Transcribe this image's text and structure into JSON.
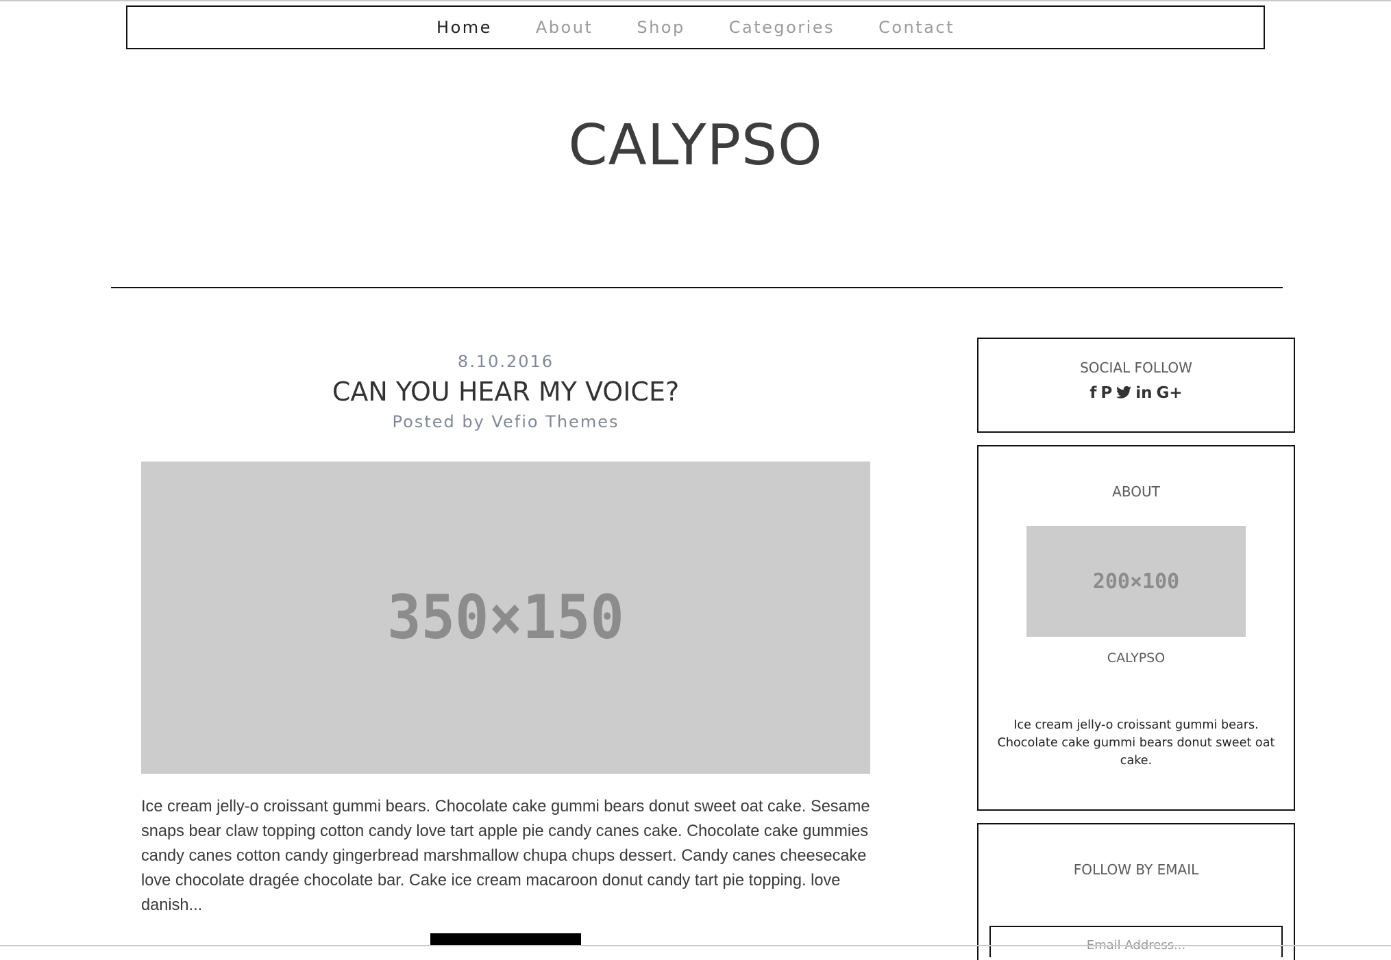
{
  "nav": {
    "items": [
      {
        "label": "Home",
        "active": true
      },
      {
        "label": "About",
        "active": false
      },
      {
        "label": "Shop",
        "active": false
      },
      {
        "label": "Categories",
        "active": false
      },
      {
        "label": "Contact",
        "active": false
      }
    ]
  },
  "site": {
    "title": "CALYPSO"
  },
  "post": {
    "date": "8.10.2016",
    "title": "CAN YOU HEAR MY VOICE?",
    "author": "Posted by Vefio Themes",
    "image_label": "350×150",
    "excerpt": "Ice cream jelly-o croissant gummi bears. Chocolate cake gummi bears donut sweet oat cake. Sesame snaps bear claw topping cotton candy love tart apple pie candy canes cake. Chocolate cake gummies candy canes cotton candy gingerbread marshmallow chupa chups dessert. Candy canes cheesecake love chocolate dragée chocolate bar. Cake ice cream macaroon donut candy tart pie topping. love danish..."
  },
  "sidebar": {
    "social": {
      "title": "SOCIAL FOLLOW",
      "icons": [
        {
          "name": "facebook-icon",
          "glyph": "f"
        },
        {
          "name": "pinterest-icon",
          "glyph": "P"
        },
        {
          "name": "twitter-icon",
          "glyph": "t"
        },
        {
          "name": "linkedin-icon",
          "glyph": "in"
        },
        {
          "name": "google-plus-icon",
          "glyph": "G+"
        }
      ]
    },
    "about": {
      "title": "ABOUT",
      "image_label": "200×100",
      "name": "CALYPSO",
      "text": "Ice cream jelly-o croissant gummi bears. Chocolate cake gummi bears donut sweet oat cake."
    },
    "email": {
      "title": "FOLLOW BY EMAIL",
      "placeholder": "Email Address..."
    }
  },
  "colors": {
    "text_dark": "#333333",
    "text_muted": "#808896",
    "nav_inactive": "#9a9a9a",
    "placeholder_bg": "#cccccc",
    "border": "#111111"
  }
}
